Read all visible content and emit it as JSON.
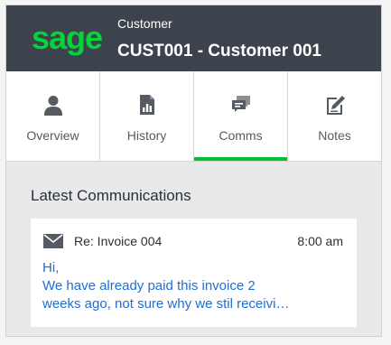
{
  "header": {
    "logo_text": "sage",
    "kicker": "Customer",
    "title": "CUST001 - Customer 001",
    "logo_color": "#00d639",
    "background": "#3d434c"
  },
  "tabs": [
    {
      "label": "Overview",
      "icon": "person-icon",
      "active": false
    },
    {
      "label": "History",
      "icon": "document-chart-icon",
      "active": false
    },
    {
      "label": "Comms",
      "icon": "chat-icon",
      "active": true
    },
    {
      "label": "Notes",
      "icon": "edit-note-icon",
      "active": false
    }
  ],
  "accent_color": "#00c132",
  "latest": {
    "heading": "Latest Communications",
    "items": [
      {
        "icon": "envelope-icon",
        "subject": "Re: Invoice 004",
        "time": "8:00 am",
        "preview_lines": [
          "Hi,",
          "We have already paid this invoice 2",
          "weeks ago, not sure why we stil receivi…"
        ]
      }
    ]
  }
}
